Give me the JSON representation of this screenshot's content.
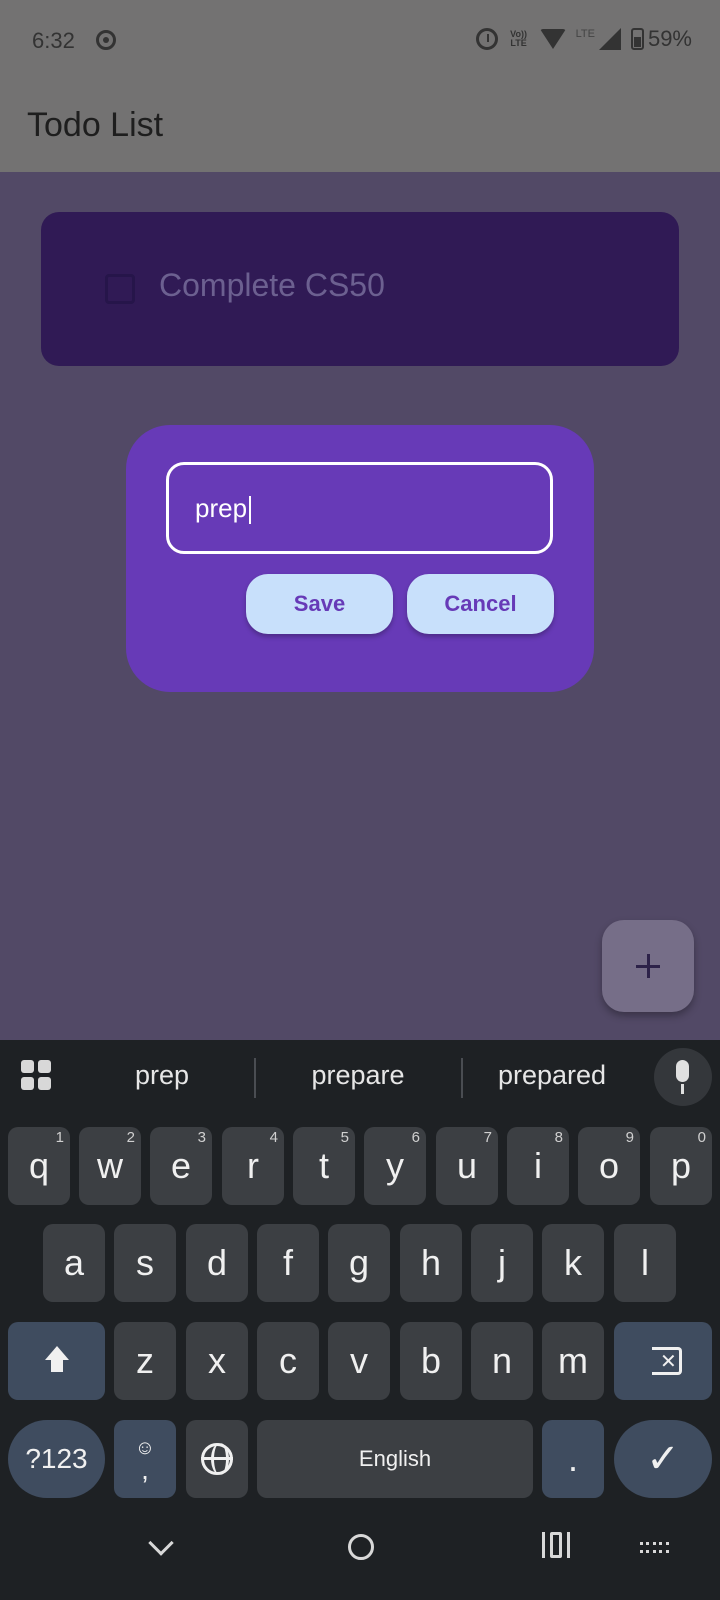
{
  "status_bar": {
    "time": "6:32",
    "volte_label": "Vo))\nLTE",
    "network_label": "LTE",
    "battery": "59%"
  },
  "app_bar": {
    "title": "Todo List"
  },
  "todos": [
    {
      "label": "Complete CS50",
      "checked": false
    }
  ],
  "dialog": {
    "input_value": "prep",
    "save_label": "Save",
    "cancel_label": "Cancel"
  },
  "fab": {
    "icon": "plus-icon"
  },
  "keyboard": {
    "suggestions": [
      "prep",
      "prepare",
      "prepared"
    ],
    "row1": [
      {
        "k": "q",
        "h": "1"
      },
      {
        "k": "w",
        "h": "2"
      },
      {
        "k": "e",
        "h": "3"
      },
      {
        "k": "r",
        "h": "4"
      },
      {
        "k": "t",
        "h": "5"
      },
      {
        "k": "y",
        "h": "6"
      },
      {
        "k": "u",
        "h": "7"
      },
      {
        "k": "i",
        "h": "8"
      },
      {
        "k": "o",
        "h": "9"
      },
      {
        "k": "p",
        "h": "0"
      }
    ],
    "row2": [
      "a",
      "s",
      "d",
      "f",
      "g",
      "h",
      "j",
      "k",
      "l"
    ],
    "row3": [
      "z",
      "x",
      "c",
      "v",
      "b",
      "n",
      "m"
    ],
    "symbols_label": "?123",
    "emoji_label": "☺",
    "comma_label": ",",
    "space_label": "English",
    "period_label": ".",
    "enter_icon": "check-icon",
    "shift_icon": "shift-icon",
    "backspace_icon": "backspace-icon",
    "globe_icon": "globe-icon"
  },
  "colors": {
    "scrim": "#524966",
    "todo_card": "#301a55",
    "dialog": "#673ab7",
    "dialog_button": "#c8e0fb",
    "keyboard_bg": "#1e2124",
    "key_bg": "#3c3f43",
    "special_key_bg": "#3f4c5f"
  }
}
